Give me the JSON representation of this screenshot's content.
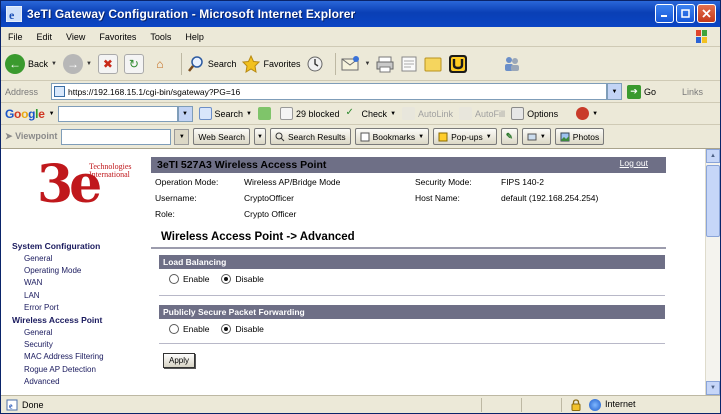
{
  "window": {
    "title": "3eTI Gateway Configuration - Microsoft Internet Explorer",
    "controls": [
      "minimize",
      "maximize",
      "close"
    ]
  },
  "menu": [
    "File",
    "Edit",
    "View",
    "Favorites",
    "Tools",
    "Help"
  ],
  "toolbar": {
    "back_label": "Back",
    "search_label": "Search",
    "favorites_label": "Favorites"
  },
  "address": {
    "label": "Address",
    "url": "https://192.168.15.1/cgi-bin/sgateway?PG=16",
    "go_label": "Go",
    "links_label": "Links"
  },
  "google_bar": {
    "logo": [
      "G",
      "o",
      "o",
      "g",
      "l",
      "e"
    ],
    "search_label": "Search",
    "blocked_label": "29 blocked",
    "check_label": "Check",
    "autolink_label": "AutoLink",
    "autofill_label": "AutoFill",
    "options_label": "Options"
  },
  "viewpoint_bar": {
    "logo": "Viewpoint",
    "web_search": "Web Search",
    "search_results": "Search Results",
    "bookmarks": "Bookmarks",
    "popups": "Pop-ups",
    "photos": "Photos"
  },
  "left_nav": {
    "logo_mark": "3e",
    "logo_text_1": "Technologies",
    "logo_text_2": "International",
    "system_configuration": "System Configuration",
    "system_items": [
      "General",
      "Operating Mode",
      "WAN",
      "LAN",
      "Error Port"
    ],
    "wireless_access_point": "Wireless Access Point",
    "wap_items": [
      "General",
      "Security",
      "MAC Address Filtering",
      "Rogue AP Detection",
      "Advanced"
    ]
  },
  "header": {
    "product_title": "3eTI 527A3 Wireless Access Point",
    "logout": "Log out",
    "operation_mode_label": "Operation Mode:",
    "operation_mode_value": "Wireless AP/Bridge Mode",
    "security_mode_label": "Security Mode:",
    "security_mode_value": "FIPS 140-2",
    "username_label": "Username:",
    "username_value": "CryptoOfficer",
    "host_name_label": "Host Name:",
    "host_name_value": "default (192.168.254.254)",
    "role_label": "Role:",
    "role_value": "Crypto Officer"
  },
  "page": {
    "heading": "Wireless Access Point -> Advanced",
    "load_balancing": {
      "title": "Load Balancing",
      "enable_label": "Enable",
      "disable_label": "Disable",
      "selected": "Disable"
    },
    "packet_forwarding": {
      "title": "Publicly Secure Packet Forwarding",
      "enable_label": "Enable",
      "disable_label": "Disable",
      "selected": "Disable"
    },
    "apply_label": "Apply"
  },
  "status_bar": {
    "status_text": "Done",
    "zone_label": "Internet"
  }
}
